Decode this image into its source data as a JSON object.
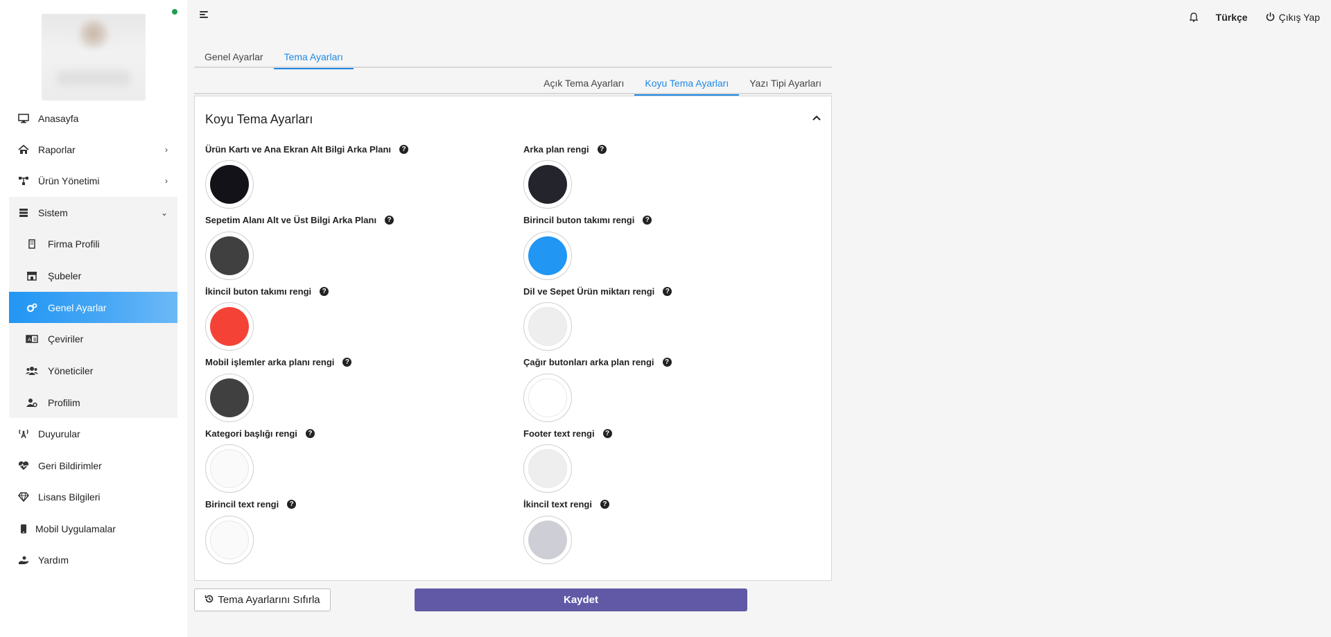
{
  "header": {
    "language": "Türkçe",
    "logout_label": "Çıkış Yap"
  },
  "sidebar": {
    "items": [
      {
        "label": "Anasayfa",
        "icon": "monitor-icon"
      },
      {
        "label": "Raporlar",
        "icon": "report-icon"
      },
      {
        "label": "Ürün Yönetimi",
        "icon": "sitemap-icon"
      },
      {
        "label": "Sistem",
        "icon": "server-icon"
      },
      {
        "label": "Firma Profili",
        "icon": "building-icon"
      },
      {
        "label": "Şubeler",
        "icon": "store-icon"
      },
      {
        "label": "Genel Ayarlar",
        "icon": "gears-icon"
      },
      {
        "label": "Çeviriler",
        "icon": "translate-icon"
      },
      {
        "label": "Yöneticiler",
        "icon": "users-icon"
      },
      {
        "label": "Profilim",
        "icon": "user-gear-icon"
      },
      {
        "label": "Duyurular",
        "icon": "broadcast-icon"
      },
      {
        "label": "Geri Bildirimler",
        "icon": "heart-pulse-icon"
      },
      {
        "label": "Lisans Bilgileri",
        "icon": "gem-icon"
      },
      {
        "label": "Mobil Uygulamalar",
        "icon": "mobile-icon"
      },
      {
        "label": "Yardım",
        "icon": "hand-holding-icon"
      }
    ]
  },
  "tabs": {
    "main": [
      "Genel Ayarlar",
      "Tema Ayarları"
    ],
    "active_main": "Tema Ayarları",
    "sub": [
      "Açık Tema Ayarları",
      "Koyu Tema Ayarları",
      "Yazı Tipi Ayarları"
    ],
    "active_sub": "Koyu Tema Ayarları"
  },
  "card": {
    "title": "Koyu Tema Ayarları",
    "fields": [
      {
        "label": "Ürün Kartı ve Ana Ekran Alt Bilgi Arka Planı",
        "color": "#121218"
      },
      {
        "label": "Arka plan rengi",
        "color": "#24242c"
      },
      {
        "label": "Sepetim Alanı Alt ve Üst Bilgi Arka Planı",
        "color": "#404040"
      },
      {
        "label": "Birincil buton takımı rengi",
        "color": "#2196f3"
      },
      {
        "label": "İkincil buton takımı rengi",
        "color": "#f44336"
      },
      {
        "label": "Dil ve Sepet Ürün miktarı rengi",
        "color": "#eeeeee"
      },
      {
        "label": "Mobil işlemler arka planı rengi",
        "color": "#404040"
      },
      {
        "label": "Çağır butonları arka plan rengi",
        "color": "#ffffff"
      },
      {
        "label": "Kategori başlığı rengi",
        "color": "#fafafa"
      },
      {
        "label": "Footer text rengi",
        "color": "#eeeeee"
      },
      {
        "label": "Birincil text rengi",
        "color": "#fafafa"
      },
      {
        "label": "İkincil text rengi",
        "color": "#ceced6"
      }
    ]
  },
  "buttons": {
    "reset_label": "Tema Ayarlarını Sıfırla",
    "save_label": "Kaydet"
  },
  "colors": {
    "accent": "#2196f3",
    "save": "#6259a6",
    "online": "#1e9e4e"
  }
}
